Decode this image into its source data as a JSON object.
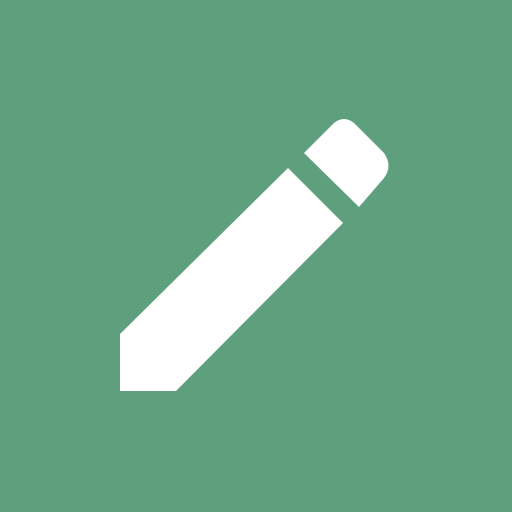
{
  "app": {
    "icon": "pencil-icon",
    "colors": {
      "background": "#5e9f7d",
      "foreground": "#ffffff"
    }
  }
}
